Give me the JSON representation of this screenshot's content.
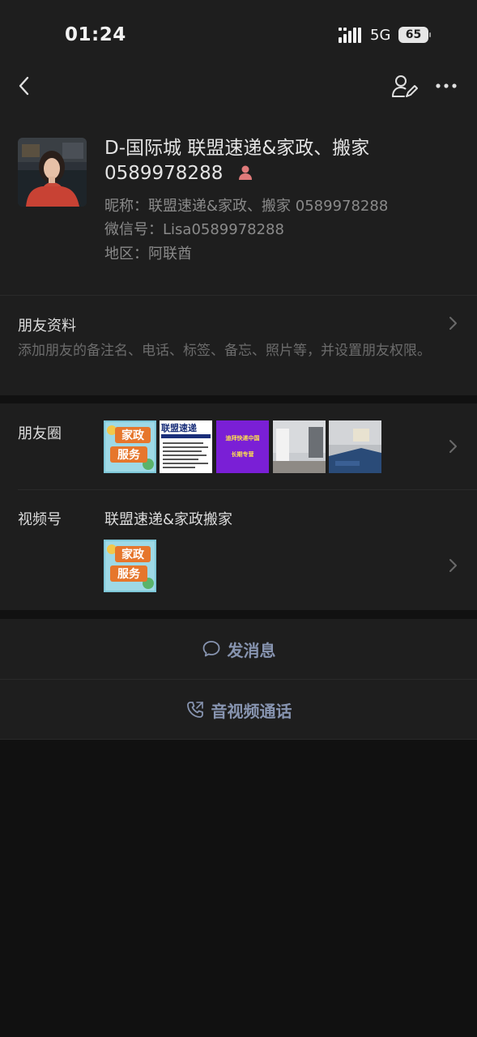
{
  "status_bar": {
    "time": "01:24",
    "network": "5G",
    "battery": "65"
  },
  "nav": {
    "back_icon": "chevron-left-icon",
    "edit_icon": "edit-user-icon",
    "more_icon": "more-dots-icon"
  },
  "profile": {
    "name": "D-国际城 联盟速递&家政、搬家 0589978288",
    "nickname_label": "昵称：",
    "nickname": "联盟速递&家政、搬家 0589978288",
    "wechat_id_label": "微信号：",
    "wechat_id": "Lisa0589978288",
    "region_label": "地区：",
    "region": "阿联酋",
    "gender_icon": "female-icon"
  },
  "friend_info": {
    "title": "朋友资料",
    "description": "添加朋友的备注名、电话、标签、备忘、照片等，并设置朋友权限。"
  },
  "moments": {
    "title": "朋友圈",
    "thumbnails": [
      {
        "text_line1": "家政",
        "text_line2": "服务"
      },
      {
        "text_line1": "联盟速递"
      },
      {
        "text_line1": "迪拜快递中国",
        "text_line2": "长期专营"
      },
      {
        "text_line1": ""
      },
      {
        "text_line1": ""
      }
    ]
  },
  "channels": {
    "title": "视频号",
    "name": "联盟速递&家政搬家",
    "thumbnail": {
      "text_line1": "家政",
      "text_line2": "服务"
    }
  },
  "actions": {
    "message_label": "发消息",
    "call_label": "音视频通话"
  },
  "colors": {
    "background": "#111111",
    "panel": "#1e1e1e",
    "accent": "#8794b0",
    "muted_text": "#8a8a8a"
  }
}
